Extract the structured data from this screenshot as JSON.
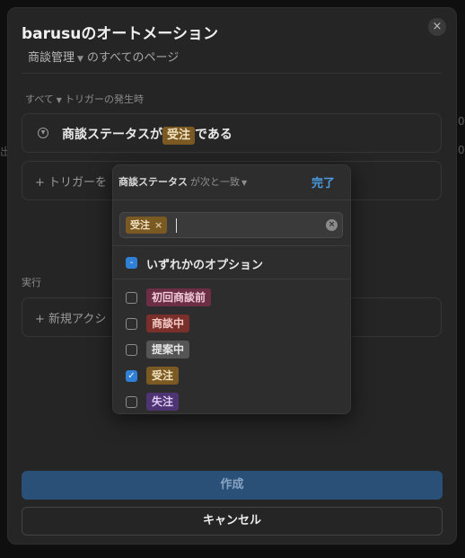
{
  "modal": {
    "title": "barusuのオートメーション",
    "close_icon": "×",
    "breadcrumb": {
      "database": "商談管理",
      "scope": "のすべてのページ"
    }
  },
  "trigger_section": {
    "label": "すべて",
    "label_suffix": "トリガーの発生時",
    "trigger": {
      "property": "商談ステータス",
      "particle": "が",
      "value": "受注",
      "suffix": "である"
    },
    "add_trigger": "+ トリガーを"
  },
  "action_section": {
    "label": "実行",
    "add_action": "+ 新規アクシ"
  },
  "buttons": {
    "create": "作成",
    "cancel": "キャンセル"
  },
  "dropdown": {
    "property": "商談ステータス",
    "operator": "が次と一致",
    "done": "完了",
    "selected_chip": "受注",
    "any_option": "いずれかのオプション",
    "options": [
      {
        "label": "初回商談前",
        "checked": false,
        "bg": "#6b2e45",
        "fg": "#f0c8d6"
      },
      {
        "label": "商談中",
        "checked": false,
        "bg": "#7a2f2a",
        "fg": "#f3c9c3"
      },
      {
        "label": "提案中",
        "checked": false,
        "bg": "#555555",
        "fg": "#e6e6e6"
      },
      {
        "label": "受注",
        "checked": true,
        "bg": "#7a5a22",
        "fg": "#f2e1c0"
      },
      {
        "label": "失注",
        "checked": false,
        "bg": "#4e3472",
        "fg": "#dccbf2"
      }
    ]
  },
  "colors": {
    "accent": "#2f80d6",
    "create_button": "#2b5077",
    "done_text": "#4a9be0"
  }
}
